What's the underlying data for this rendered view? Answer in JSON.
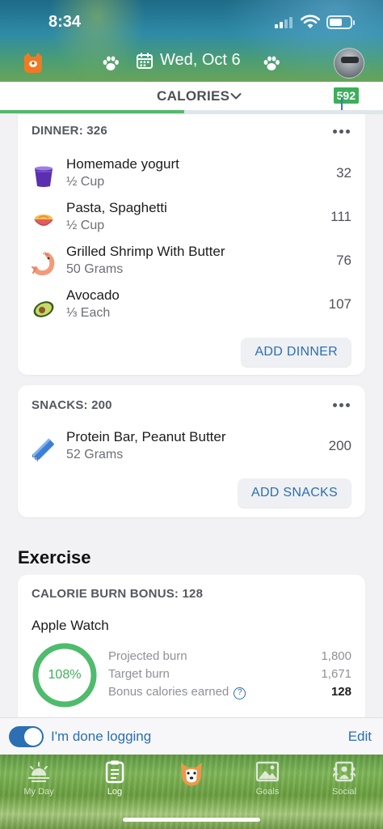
{
  "status_bar": {
    "time": "8:34"
  },
  "header": {
    "date": "Wed, Oct 6"
  },
  "calorie_bar": {
    "label": "CALORIES",
    "remaining": "592",
    "progress": 0.48
  },
  "dinner": {
    "header": "DINNER: 326",
    "items": [
      {
        "name": "Homemade yogurt",
        "qty": "½ Cup",
        "cal": "32",
        "icon": "yogurt-cup-icon"
      },
      {
        "name": "Pasta, Spaghetti",
        "qty": "½ Cup",
        "cal": "111",
        "icon": "pasta-bowl-icon"
      },
      {
        "name": "Grilled Shrimp With Butter",
        "qty": "50 Grams",
        "cal": "76",
        "icon": "shrimp-icon"
      },
      {
        "name": "Avocado",
        "qty": "⅓ Each",
        "cal": "107",
        "icon": "avocado-icon"
      }
    ],
    "add_label": "ADD DINNER"
  },
  "snacks": {
    "header": "SNACKS: 200",
    "items": [
      {
        "name": "Protein Bar, Peanut Butter",
        "qty": "52 Grams",
        "cal": "200",
        "icon": "protein-bar-icon"
      }
    ],
    "add_label": "ADD SNACKS"
  },
  "exercise": {
    "title": "Exercise",
    "card_header": "CALORIE BURN BONUS: 128",
    "device": "Apple Watch",
    "percent": "108%",
    "percent_value": 1.08,
    "rows": [
      {
        "label": "Projected burn",
        "value": "1,800"
      },
      {
        "label": "Target burn",
        "value": "1,671"
      },
      {
        "label": "Bonus calories earned",
        "value": "128"
      }
    ],
    "help_glyph": "?"
  },
  "done_bar": {
    "label": "I'm done logging",
    "edit": "Edit",
    "toggle_on": true
  },
  "tabs": [
    {
      "label": "My Day",
      "icon": "sunrise-icon"
    },
    {
      "label": "Log",
      "icon": "clipboard-icon"
    },
    {
      "label": "",
      "icon": "dog-mascot-icon"
    },
    {
      "label": "Goals",
      "icon": "goals-picture-icon"
    },
    {
      "label": "Social",
      "icon": "social-people-icon"
    }
  ],
  "colors": {
    "accent_blue": "#2a6fb5",
    "green": "#3fae5c",
    "progress_green": "#55b86b"
  }
}
